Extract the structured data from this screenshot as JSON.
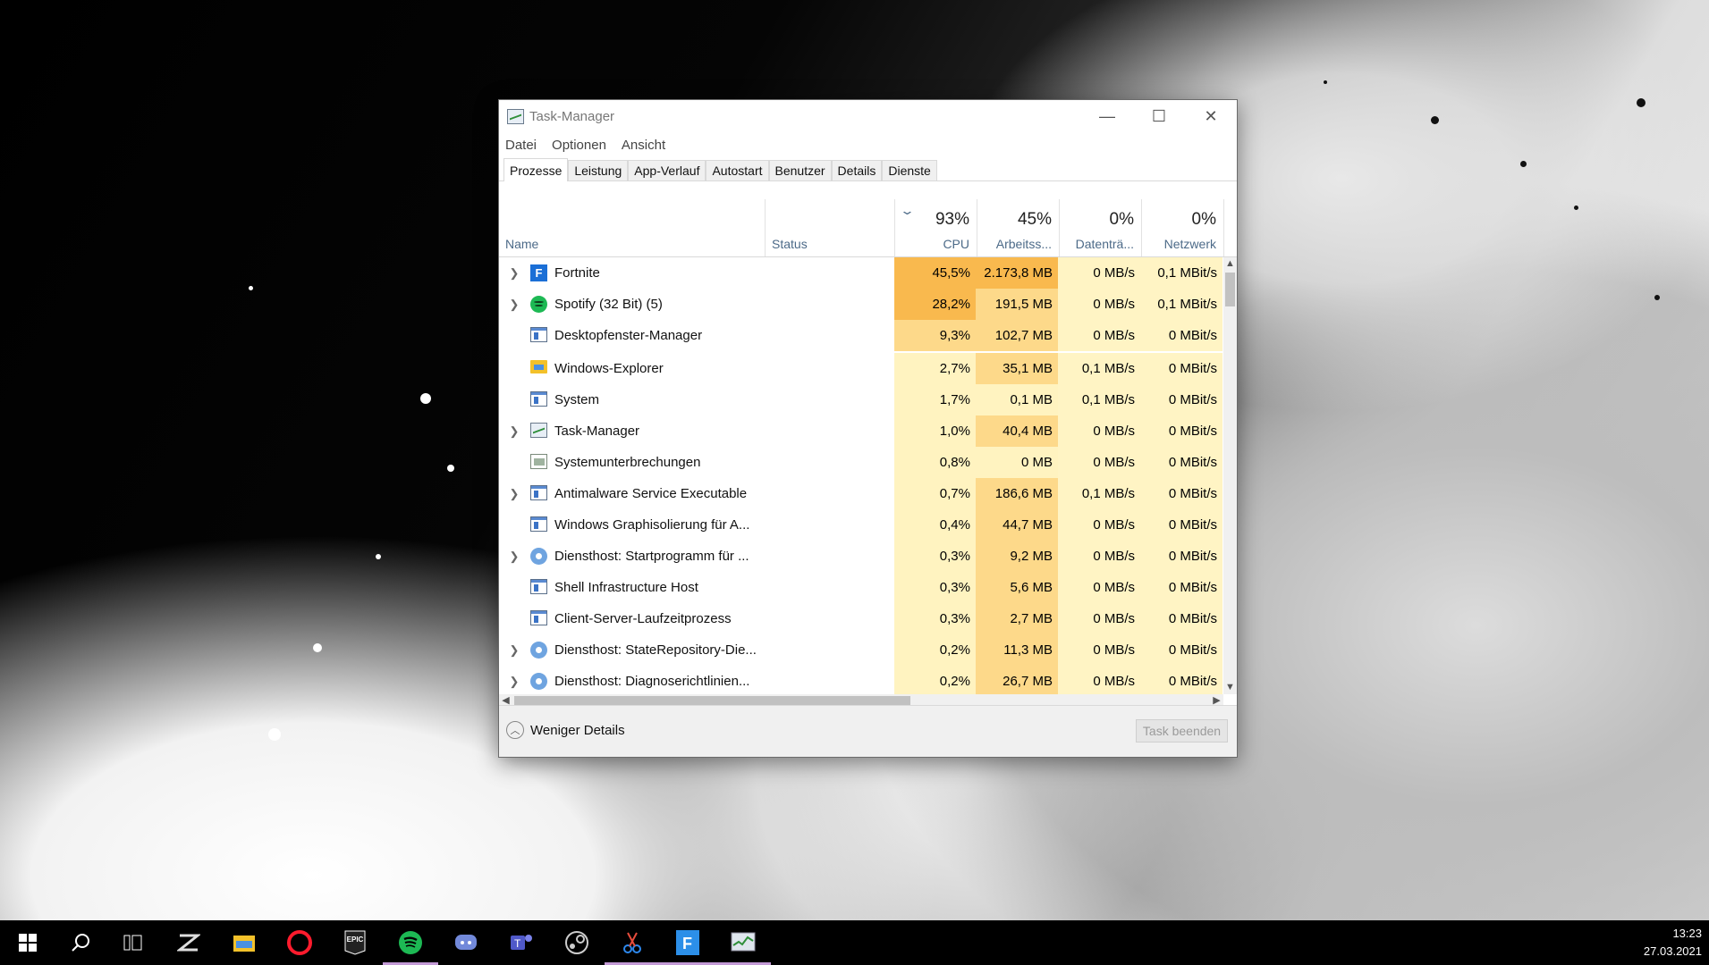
{
  "window": {
    "title": "Task-Manager",
    "controls": {
      "minimize": "—",
      "maximize": "☐",
      "close": "✕"
    }
  },
  "menu": [
    "Datei",
    "Optionen",
    "Ansicht"
  ],
  "tabs": [
    "Prozesse",
    "Leistung",
    "App-Verlauf",
    "Autostart",
    "Benutzer",
    "Details",
    "Dienste"
  ],
  "active_tab": "Prozesse",
  "columns": {
    "name": "Name",
    "status": "Status",
    "cpu": {
      "pct": "93%",
      "label": "CPU"
    },
    "memory": {
      "pct": "45%",
      "label": "Arbeitss..."
    },
    "disk": {
      "pct": "0%",
      "label": "Datenträ..."
    },
    "network": {
      "pct": "0%",
      "label": "Netzwerk"
    }
  },
  "processes": [
    {
      "name": "Fortnite",
      "expandable": true,
      "icon": "fortnite-icon",
      "cpu": "45,5%",
      "mem": "2.173,8 MB",
      "disk": "0 MB/s",
      "net": "0,1 MBit/s"
    },
    {
      "name": "Spotify (32 Bit) (5)",
      "expandable": true,
      "icon": "spotify-icon",
      "cpu": "28,2%",
      "mem": "191,5 MB",
      "disk": "0 MB/s",
      "net": "0,1 MBit/s"
    },
    {
      "name": "Desktopfenster-Manager",
      "expandable": false,
      "icon": "window-icon",
      "cpu": "9,3%",
      "mem": "102,7 MB",
      "disk": "0 MB/s",
      "net": "0 MBit/s"
    },
    {
      "name": "Windows-Explorer",
      "expandable": false,
      "icon": "folder-icon",
      "cpu": "2,7%",
      "mem": "35,1 MB",
      "disk": "0,1 MB/s",
      "net": "0 MBit/s"
    },
    {
      "name": "System",
      "expandable": false,
      "icon": "window-icon",
      "cpu": "1,7%",
      "mem": "0,1 MB",
      "disk": "0,1 MB/s",
      "net": "0 MBit/s"
    },
    {
      "name": "Task-Manager",
      "expandable": true,
      "icon": "task-manager-icon",
      "cpu": "1,0%",
      "mem": "40,4 MB",
      "disk": "0 MB/s",
      "net": "0 MBit/s"
    },
    {
      "name": "Systemunterbrechungen",
      "expandable": false,
      "icon": "system-interrupts-icon",
      "cpu": "0,8%",
      "mem": "0 MB",
      "disk": "0 MB/s",
      "net": "0 MBit/s"
    },
    {
      "name": "Antimalware Service Executable",
      "expandable": true,
      "icon": "window-icon",
      "cpu": "0,7%",
      "mem": "186,6 MB",
      "disk": "0,1 MB/s",
      "net": "0 MBit/s"
    },
    {
      "name": "Windows Graphisolierung für A...",
      "expandable": false,
      "icon": "window-icon",
      "cpu": "0,4%",
      "mem": "44,7 MB",
      "disk": "0 MB/s",
      "net": "0 MBit/s"
    },
    {
      "name": "Diensthost: Startprogramm für ...",
      "expandable": true,
      "icon": "gear-icon",
      "cpu": "0,3%",
      "mem": "9,2 MB",
      "disk": "0 MB/s",
      "net": "0 MBit/s"
    },
    {
      "name": "Shell Infrastructure Host",
      "expandable": false,
      "icon": "window-icon",
      "cpu": "0,3%",
      "mem": "5,6 MB",
      "disk": "0 MB/s",
      "net": "0 MBit/s"
    },
    {
      "name": "Client-Server-Laufzeitprozess",
      "expandable": false,
      "icon": "window-icon",
      "cpu": "0,3%",
      "mem": "2,7 MB",
      "disk": "0 MB/s",
      "net": "0 MBit/s"
    },
    {
      "name": "Diensthost: StateRepository-Die...",
      "expandable": true,
      "icon": "gear-icon",
      "cpu": "0,2%",
      "mem": "11,3 MB",
      "disk": "0 MB/s",
      "net": "0 MBit/s"
    },
    {
      "name": "Diensthost: Diagnoserichtlinien...",
      "expandable": true,
      "icon": "gear-icon",
      "cpu": "0,2%",
      "mem": "26,7 MB",
      "disk": "0 MB/s",
      "net": "0 MBit/s"
    }
  ],
  "footer": {
    "less_details": "Weniger Details",
    "end_task": "Task beenden"
  },
  "heat_colors": {
    "high": "#f9b94e",
    "medium": "#fdd98a",
    "low": "#fff3c0",
    "base": "#fff4c4"
  },
  "taskbar": {
    "items": [
      "windows-start-icon",
      "search-icon",
      "task-view-icon",
      "app-icon",
      "file-explorer-icon",
      "opera-icon",
      "epic-games-icon",
      "spotify-icon",
      "discord-icon",
      "teams-icon",
      "steam-icon",
      "snipping-tool-icon",
      "fortnite-icon",
      "task-manager-icon"
    ],
    "epic_label": "EPIC",
    "time": "13:23",
    "date": "27.03.2021"
  }
}
